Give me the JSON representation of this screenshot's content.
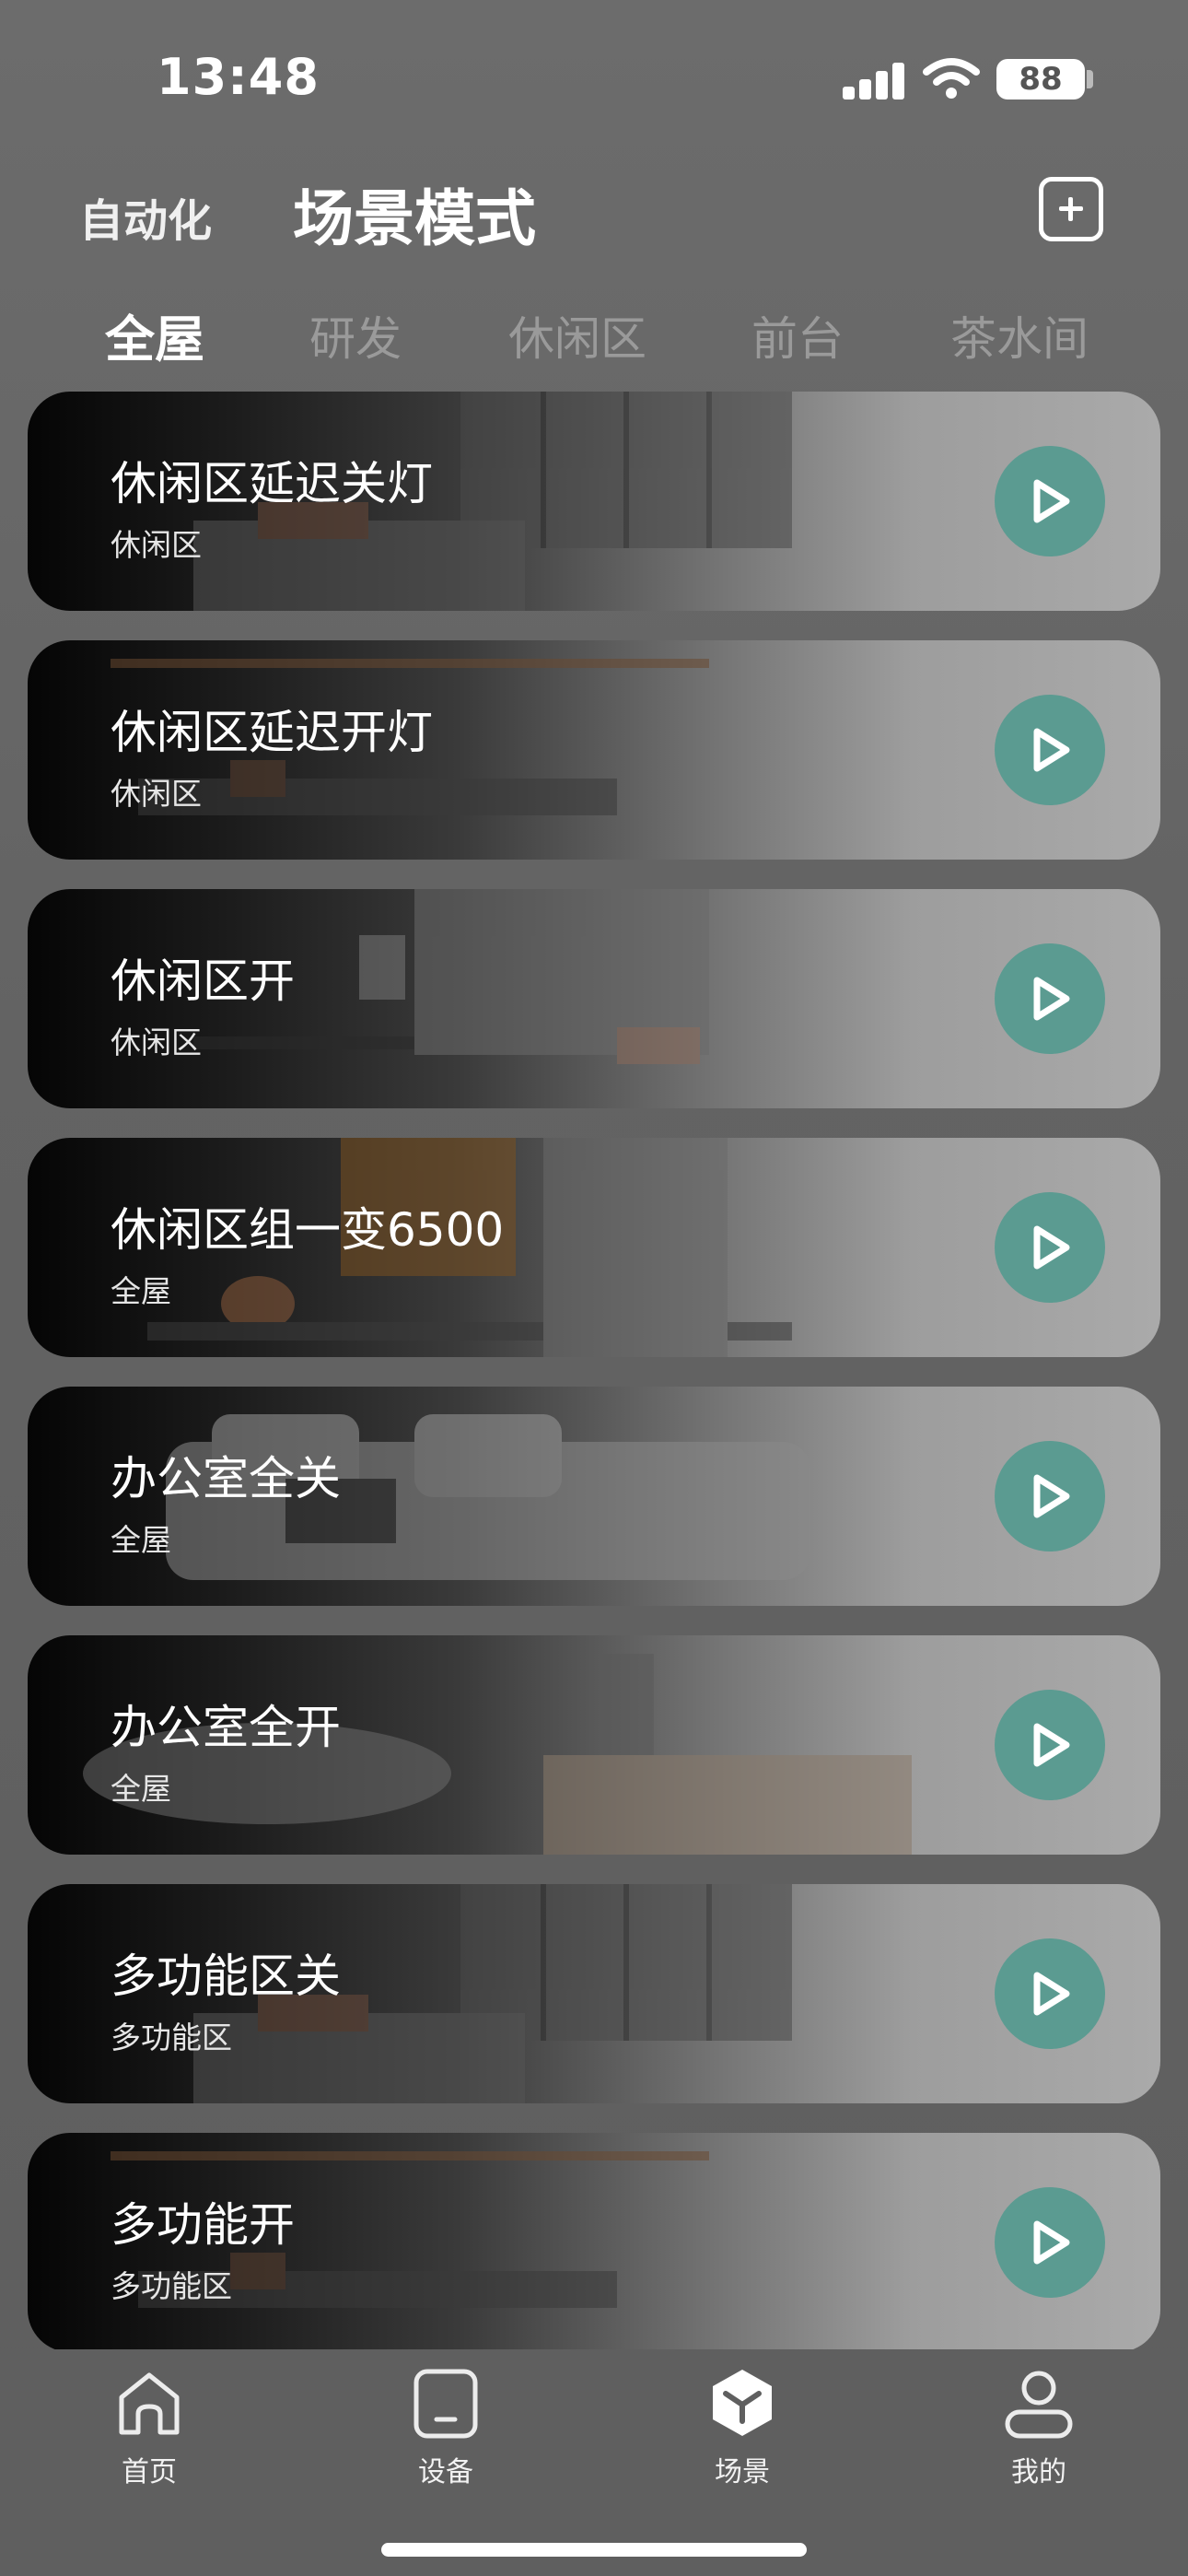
{
  "status_bar": {
    "time": "13:48",
    "battery": "88"
  },
  "header": {
    "automation_tab": "自动化",
    "title": "场景模式"
  },
  "room_tabs": [
    "全屋",
    "研发",
    "休闲区",
    "前台",
    "茶水间"
  ],
  "scenes": [
    {
      "title": "休闲区延迟关灯",
      "room": "休闲区"
    },
    {
      "title": "休闲区延迟开灯",
      "room": "休闲区"
    },
    {
      "title": "休闲区开",
      "room": "休闲区"
    },
    {
      "title": "休闲区组一变6500",
      "room": "全屋"
    },
    {
      "title": "办公室全关",
      "room": "全屋"
    },
    {
      "title": "办公室全开",
      "room": "全屋"
    },
    {
      "title": "多功能区关",
      "room": "多功能区"
    },
    {
      "title": "多功能开",
      "room": "多功能区"
    }
  ],
  "bottom_nav": [
    "首页",
    "设备",
    "场景",
    "我的"
  ],
  "colors": {
    "play_button": "#5b9b91",
    "background": "#636363"
  },
  "icons": {
    "header_action": "add-square-icon",
    "scene_action": "play-icon",
    "nav": [
      "home-icon",
      "device-icon",
      "scene-icon",
      "profile-icon"
    ]
  }
}
